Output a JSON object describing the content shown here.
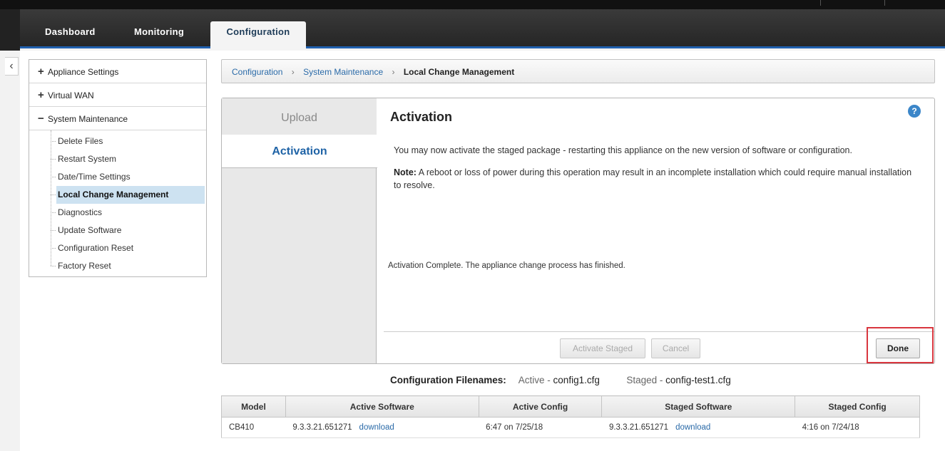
{
  "nav": {
    "tabs": [
      {
        "label": "Dashboard"
      },
      {
        "label": "Monitoring"
      },
      {
        "label": "Configuration"
      }
    ]
  },
  "sidebar": {
    "sections": [
      {
        "label": "Appliance Settings",
        "toggle": "+"
      },
      {
        "label": "Virtual WAN",
        "toggle": "+"
      },
      {
        "label": "System Maintenance",
        "toggle": "−"
      }
    ],
    "items": [
      {
        "label": "Delete Files"
      },
      {
        "label": "Restart System"
      },
      {
        "label": "Date/Time Settings"
      },
      {
        "label": "Local Change Management"
      },
      {
        "label": "Diagnostics"
      },
      {
        "label": "Update Software"
      },
      {
        "label": "Configuration Reset"
      },
      {
        "label": "Factory Reset"
      }
    ],
    "collapse_glyph": "‹"
  },
  "breadcrumb": {
    "items": [
      "Configuration",
      "System Maintenance"
    ],
    "current": "Local Change Management",
    "separator": "›"
  },
  "wizard": {
    "steps": {
      "upload": "Upload",
      "activation": "Activation"
    },
    "title": "Activation",
    "help_glyph": "?",
    "description": "You may now activate the staged package - restarting this appliance on the new version of software or configuration.",
    "note_label": "Note:",
    "note_text": " A reboot or loss of power during this operation may result in an incomplete installation which could require manual installation to resolve.",
    "status": "Activation Complete. The appliance change process has finished.",
    "buttons": {
      "activate": "Activate Staged",
      "cancel": "Cancel",
      "done": "Done"
    }
  },
  "config_filenames": {
    "label": "Configuration Filenames:",
    "active_label": "Active",
    "active_value": "config1.cfg",
    "staged_label": "Staged",
    "staged_value": "config-test1.cfg",
    "dash": " - "
  },
  "table": {
    "headers": [
      "Model",
      "Active Software",
      "Active Config",
      "Staged Software",
      "Staged Config"
    ],
    "row": {
      "model": "CB410",
      "active_software": "9.3.3.21.651271",
      "active_download": "download",
      "active_config": "6:47 on 7/25/18",
      "staged_software": "9.3.3.21.651271",
      "staged_download": "download",
      "staged_config": "4:16 on 7/24/18"
    }
  },
  "colors": {
    "accent": "#1f63a6",
    "highlight_border": "#d9363e",
    "selected_item_bg": "#cde2f1"
  }
}
